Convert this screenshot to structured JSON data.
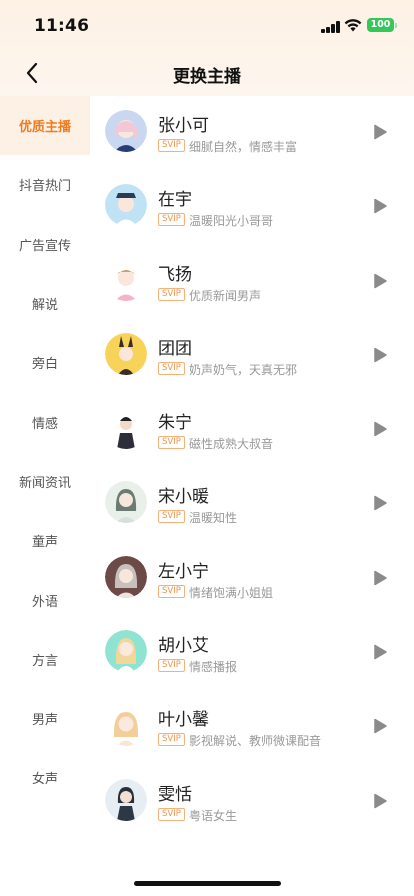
{
  "status_bar": {
    "time": "11:46",
    "battery": "100"
  },
  "nav": {
    "title": "更换主播",
    "back_icon": "chevron-left-icon"
  },
  "sidebar": {
    "items": [
      {
        "label": "优质主播",
        "active": true
      },
      {
        "label": "抖音热门",
        "active": false
      },
      {
        "label": "广告宣传",
        "active": false
      },
      {
        "label": "解说",
        "active": false
      },
      {
        "label": "旁白",
        "active": false
      },
      {
        "label": "情感",
        "active": false
      },
      {
        "label": "新闻资讯",
        "active": false
      },
      {
        "label": "童声",
        "active": false
      },
      {
        "label": "外语",
        "active": false
      },
      {
        "label": "方言",
        "active": false
      },
      {
        "label": "男声",
        "active": false
      },
      {
        "label": "女声",
        "active": false
      }
    ]
  },
  "anchors": [
    {
      "name": "张小可",
      "badge": "SVIP",
      "desc": "细腻自然，情感丰富",
      "avatar_bg": "#c9d8f0"
    },
    {
      "name": "在宇",
      "badge": "SVIP",
      "desc": "温暖阳光小哥哥",
      "avatar_bg": "#bfe3f5"
    },
    {
      "name": "飞扬",
      "badge": "SVIP",
      "desc": "优质新闻男声",
      "avatar_bg": "#ffffff"
    },
    {
      "name": "团团",
      "badge": "SVIP",
      "desc": "奶声奶气，天真无邪",
      "avatar_bg": "#f7d35a"
    },
    {
      "name": "朱宁",
      "badge": "SVIP",
      "desc": "磁性成熟大叔音",
      "avatar_bg": "#ffffff"
    },
    {
      "name": "宋小暖",
      "badge": "SVIP",
      "desc": "温暖知性",
      "avatar_bg": "#e9efe9"
    },
    {
      "name": "左小宁",
      "badge": "SVIP",
      "desc": "情绪饱满小姐姐",
      "avatar_bg": "#6b4a48"
    },
    {
      "name": "胡小艾",
      "badge": "SVIP",
      "desc": "情感播报",
      "avatar_bg": "#8fe3d2"
    },
    {
      "name": "叶小馨",
      "badge": "SVIP",
      "desc": "影视解说、教师微课配音",
      "avatar_bg": "#ffffff"
    },
    {
      "name": "雯恬",
      "badge": "SVIP",
      "desc": "粤语女生",
      "avatar_bg": "#e6eef3"
    }
  ],
  "colors": {
    "accent": "#f07c20",
    "sidebar_active_bg": "#fdf0e4",
    "badge": "#f0924a",
    "play_icon": "#8a8a8a"
  }
}
